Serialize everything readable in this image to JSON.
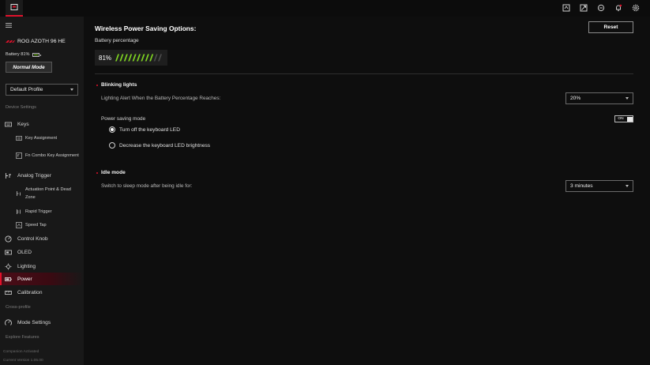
{
  "device": {
    "name": "ROG AZOTH 96 HE",
    "battery_label": "Battery 81%"
  },
  "mode": {
    "label": "Normal Mode"
  },
  "profile": {
    "selected": "Default Profile"
  },
  "sidebar": {
    "device_settings_label": "Device Settings",
    "keys": "Keys",
    "key_assignment": "Key Assignment",
    "fn_combo": "Fn Combo Key Assignment",
    "analog_trigger": "Analog Trigger",
    "actuation": "Actuation Point & Dead Zone",
    "rapid_trigger": "Rapid Trigger",
    "speed_tap": "Speed Tap",
    "control_knob": "Control Knob",
    "oled": "OLED",
    "lighting": "Lighting",
    "power": "Power",
    "calibration": "Calibration",
    "cross_profile_label": "Cross-profile",
    "mode_settings": "Mode Settings",
    "explore_features": "Explore Features",
    "companion": "Companion Activated",
    "version": "Current Version 1.05.00"
  },
  "main": {
    "title": "Wireless Power Saving Options:",
    "reset": "Reset",
    "battery_percentage_label": "Battery percentage",
    "battery_value": "81%",
    "battery_level": 0.81,
    "blinking": {
      "heading": "Blinking lights",
      "alert_label": "Lighting Alert When the Battery Percentage Reaches:",
      "alert_value": "20%"
    },
    "power_saving": {
      "label": "Power saving mode",
      "toggle_text": "ON",
      "option_off": "Turn off the keyboard LED",
      "option_dim": "Decrease the keyboard LED brightness"
    },
    "idle": {
      "heading": "Idle mode",
      "sleep_label": "Switch to sleep mode after being idle for:",
      "sleep_value": "3 minutes"
    }
  },
  "colors": {
    "accent": "#e0112b",
    "battery_green": "#7ed321"
  }
}
